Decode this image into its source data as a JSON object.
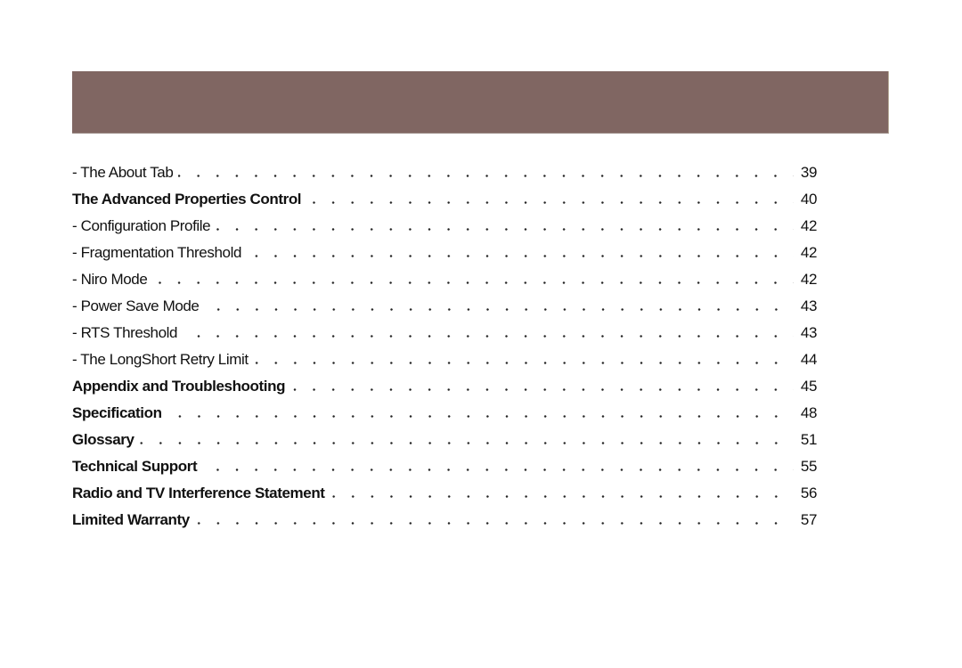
{
  "banner": {
    "color": "#806662"
  },
  "toc": {
    "entries": [
      {
        "title": "- The About Tab",
        "page": "39",
        "bold": false
      },
      {
        "title": "The Advanced Properties Control",
        "page": "40",
        "bold": true
      },
      {
        "title": "- Configuration Profile",
        "page": "42",
        "bold": false
      },
      {
        "title": "- Fragmentation Threshold",
        "page": "42",
        "bold": false
      },
      {
        "title": "- Niro Mode",
        "page": "42",
        "bold": false
      },
      {
        "title": "- Power Save Mode",
        "page": "43",
        "bold": false
      },
      {
        "title": "- RTS Threshold",
        "page": "43",
        "bold": false
      },
      {
        "title": "- The LongShort Retry Limit",
        "page": "44",
        "bold": false
      },
      {
        "title": "Appendix and Troubleshooting",
        "page": "45",
        "bold": true
      },
      {
        "title": "Specification",
        "page": "48",
        "bold": true
      },
      {
        "title": "Glossary",
        "page": "51",
        "bold": true
      },
      {
        "title": "Technical Support",
        "page": "55",
        "bold": true
      },
      {
        "title": "Radio and TV Interference Statement",
        "page": "56",
        "bold": true
      },
      {
        "title": "Limited Warranty",
        "page": "57",
        "bold": true
      }
    ]
  }
}
